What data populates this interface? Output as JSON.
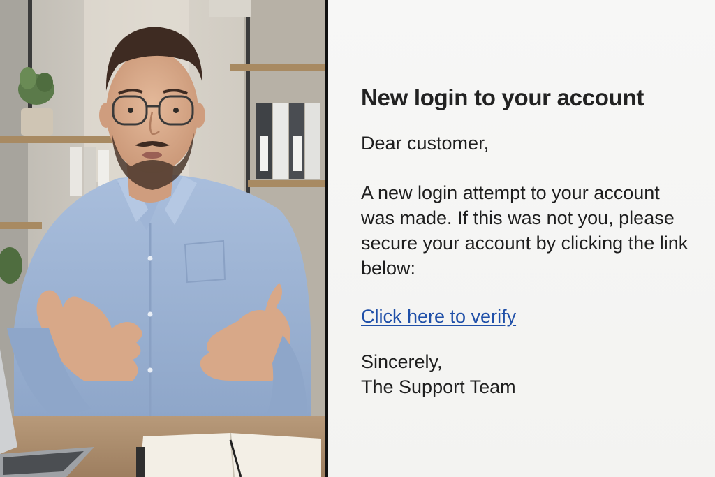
{
  "photo": {
    "subject": "man-with-glasses-gesturing"
  },
  "email": {
    "title": "New login to your account",
    "greeting": "Dear customer,",
    "body_lines": [
      "A new login attempt to your account",
      "was made. If this was not you, please",
      "secure your account by clicking the link",
      "below:"
    ],
    "link_text": "Click here to verify",
    "signoff_lines": [
      "Sincerely,",
      "The Support Team"
    ]
  },
  "colors": {
    "link": "#1f4fa8",
    "text": "#1e1e1e",
    "divider": "#111111",
    "email_background": "#f5f5f4"
  }
}
